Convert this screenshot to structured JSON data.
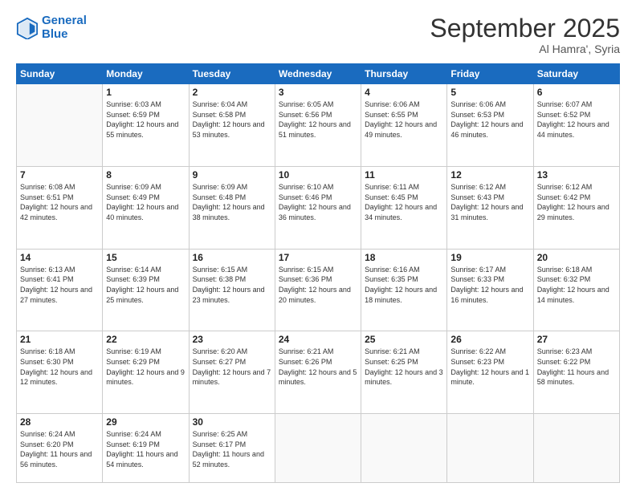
{
  "header": {
    "logo_line1": "General",
    "logo_line2": "Blue",
    "month": "September 2025",
    "location": "Al Hamra', Syria"
  },
  "weekdays": [
    "Sunday",
    "Monday",
    "Tuesday",
    "Wednesday",
    "Thursday",
    "Friday",
    "Saturday"
  ],
  "weeks": [
    [
      {
        "day": "",
        "sunrise": "",
        "sunset": "",
        "daylight": ""
      },
      {
        "day": "1",
        "sunrise": "Sunrise: 6:03 AM",
        "sunset": "Sunset: 6:59 PM",
        "daylight": "Daylight: 12 hours and 55 minutes."
      },
      {
        "day": "2",
        "sunrise": "Sunrise: 6:04 AM",
        "sunset": "Sunset: 6:58 PM",
        "daylight": "Daylight: 12 hours and 53 minutes."
      },
      {
        "day": "3",
        "sunrise": "Sunrise: 6:05 AM",
        "sunset": "Sunset: 6:56 PM",
        "daylight": "Daylight: 12 hours and 51 minutes."
      },
      {
        "day": "4",
        "sunrise": "Sunrise: 6:06 AM",
        "sunset": "Sunset: 6:55 PM",
        "daylight": "Daylight: 12 hours and 49 minutes."
      },
      {
        "day": "5",
        "sunrise": "Sunrise: 6:06 AM",
        "sunset": "Sunset: 6:53 PM",
        "daylight": "Daylight: 12 hours and 46 minutes."
      },
      {
        "day": "6",
        "sunrise": "Sunrise: 6:07 AM",
        "sunset": "Sunset: 6:52 PM",
        "daylight": "Daylight: 12 hours and 44 minutes."
      }
    ],
    [
      {
        "day": "7",
        "sunrise": "Sunrise: 6:08 AM",
        "sunset": "Sunset: 6:51 PM",
        "daylight": "Daylight: 12 hours and 42 minutes."
      },
      {
        "day": "8",
        "sunrise": "Sunrise: 6:09 AM",
        "sunset": "Sunset: 6:49 PM",
        "daylight": "Daylight: 12 hours and 40 minutes."
      },
      {
        "day": "9",
        "sunrise": "Sunrise: 6:09 AM",
        "sunset": "Sunset: 6:48 PM",
        "daylight": "Daylight: 12 hours and 38 minutes."
      },
      {
        "day": "10",
        "sunrise": "Sunrise: 6:10 AM",
        "sunset": "Sunset: 6:46 PM",
        "daylight": "Daylight: 12 hours and 36 minutes."
      },
      {
        "day": "11",
        "sunrise": "Sunrise: 6:11 AM",
        "sunset": "Sunset: 6:45 PM",
        "daylight": "Daylight: 12 hours and 34 minutes."
      },
      {
        "day": "12",
        "sunrise": "Sunrise: 6:12 AM",
        "sunset": "Sunset: 6:43 PM",
        "daylight": "Daylight: 12 hours and 31 minutes."
      },
      {
        "day": "13",
        "sunrise": "Sunrise: 6:12 AM",
        "sunset": "Sunset: 6:42 PM",
        "daylight": "Daylight: 12 hours and 29 minutes."
      }
    ],
    [
      {
        "day": "14",
        "sunrise": "Sunrise: 6:13 AM",
        "sunset": "Sunset: 6:41 PM",
        "daylight": "Daylight: 12 hours and 27 minutes."
      },
      {
        "day": "15",
        "sunrise": "Sunrise: 6:14 AM",
        "sunset": "Sunset: 6:39 PM",
        "daylight": "Daylight: 12 hours and 25 minutes."
      },
      {
        "day": "16",
        "sunrise": "Sunrise: 6:15 AM",
        "sunset": "Sunset: 6:38 PM",
        "daylight": "Daylight: 12 hours and 23 minutes."
      },
      {
        "day": "17",
        "sunrise": "Sunrise: 6:15 AM",
        "sunset": "Sunset: 6:36 PM",
        "daylight": "Daylight: 12 hours and 20 minutes."
      },
      {
        "day": "18",
        "sunrise": "Sunrise: 6:16 AM",
        "sunset": "Sunset: 6:35 PM",
        "daylight": "Daylight: 12 hours and 18 minutes."
      },
      {
        "day": "19",
        "sunrise": "Sunrise: 6:17 AM",
        "sunset": "Sunset: 6:33 PM",
        "daylight": "Daylight: 12 hours and 16 minutes."
      },
      {
        "day": "20",
        "sunrise": "Sunrise: 6:18 AM",
        "sunset": "Sunset: 6:32 PM",
        "daylight": "Daylight: 12 hours and 14 minutes."
      }
    ],
    [
      {
        "day": "21",
        "sunrise": "Sunrise: 6:18 AM",
        "sunset": "Sunset: 6:30 PM",
        "daylight": "Daylight: 12 hours and 12 minutes."
      },
      {
        "day": "22",
        "sunrise": "Sunrise: 6:19 AM",
        "sunset": "Sunset: 6:29 PM",
        "daylight": "Daylight: 12 hours and 9 minutes."
      },
      {
        "day": "23",
        "sunrise": "Sunrise: 6:20 AM",
        "sunset": "Sunset: 6:27 PM",
        "daylight": "Daylight: 12 hours and 7 minutes."
      },
      {
        "day": "24",
        "sunrise": "Sunrise: 6:21 AM",
        "sunset": "Sunset: 6:26 PM",
        "daylight": "Daylight: 12 hours and 5 minutes."
      },
      {
        "day": "25",
        "sunrise": "Sunrise: 6:21 AM",
        "sunset": "Sunset: 6:25 PM",
        "daylight": "Daylight: 12 hours and 3 minutes."
      },
      {
        "day": "26",
        "sunrise": "Sunrise: 6:22 AM",
        "sunset": "Sunset: 6:23 PM",
        "daylight": "Daylight: 12 hours and 1 minute."
      },
      {
        "day": "27",
        "sunrise": "Sunrise: 6:23 AM",
        "sunset": "Sunset: 6:22 PM",
        "daylight": "Daylight: 11 hours and 58 minutes."
      }
    ],
    [
      {
        "day": "28",
        "sunrise": "Sunrise: 6:24 AM",
        "sunset": "Sunset: 6:20 PM",
        "daylight": "Daylight: 11 hours and 56 minutes."
      },
      {
        "day": "29",
        "sunrise": "Sunrise: 6:24 AM",
        "sunset": "Sunset: 6:19 PM",
        "daylight": "Daylight: 11 hours and 54 minutes."
      },
      {
        "day": "30",
        "sunrise": "Sunrise: 6:25 AM",
        "sunset": "Sunset: 6:17 PM",
        "daylight": "Daylight: 11 hours and 52 minutes."
      },
      {
        "day": "",
        "sunrise": "",
        "sunset": "",
        "daylight": ""
      },
      {
        "day": "",
        "sunrise": "",
        "sunset": "",
        "daylight": ""
      },
      {
        "day": "",
        "sunrise": "",
        "sunset": "",
        "daylight": ""
      },
      {
        "day": "",
        "sunrise": "",
        "sunset": "",
        "daylight": ""
      }
    ]
  ]
}
